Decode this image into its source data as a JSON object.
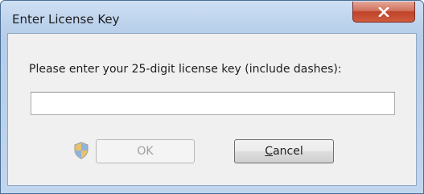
{
  "window": {
    "title": "Enter License Key",
    "close_icon": "close-x-icon"
  },
  "dialog": {
    "prompt": "Please enter your 25-digit license key (include dashes):",
    "license_key_value": "",
    "license_key_placeholder": ""
  },
  "buttons": {
    "ok_label": "OK",
    "ok_enabled": false,
    "cancel_accel": "C",
    "cancel_rest": "ancel"
  },
  "icons": {
    "shield": "uac-shield-icon"
  },
  "colors": {
    "close_button": "#c0422a",
    "titlebar": "#bcd2ec",
    "client_bg": "#f0f0f0",
    "disabled_text": "#a0a0a0"
  }
}
